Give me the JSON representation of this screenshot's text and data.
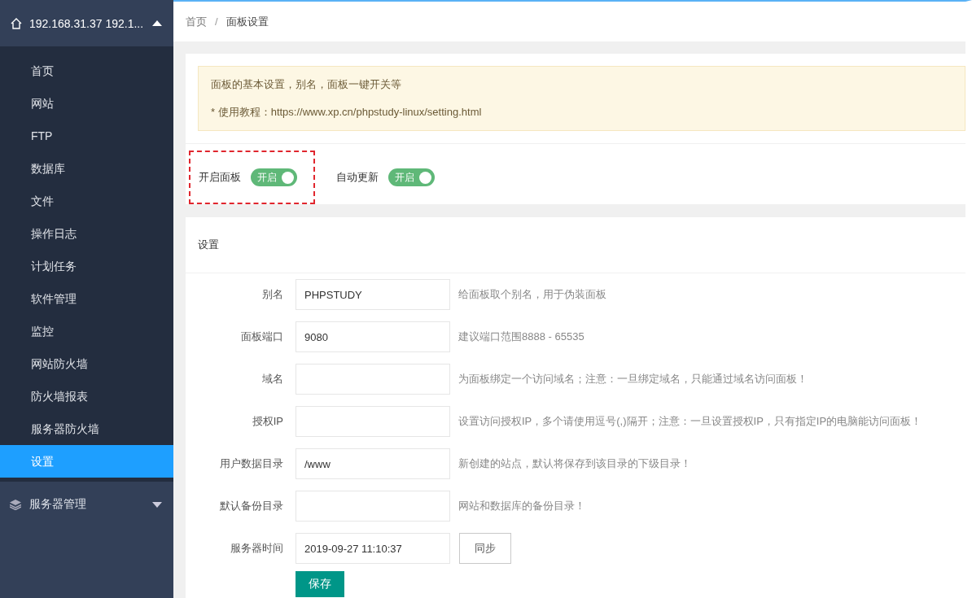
{
  "sidebar": {
    "header": {
      "title": "192.168.31.37 192.1...",
      "expanded": true
    },
    "items": [
      {
        "label": "首页",
        "selected": false
      },
      {
        "label": "网站",
        "selected": false
      },
      {
        "label": "FTP",
        "selected": false
      },
      {
        "label": "数据库",
        "selected": false
      },
      {
        "label": "文件",
        "selected": false
      },
      {
        "label": "操作日志",
        "selected": false
      },
      {
        "label": "计划任务",
        "selected": false
      },
      {
        "label": "软件管理",
        "selected": false
      },
      {
        "label": "监控",
        "selected": false
      },
      {
        "label": "网站防火墙",
        "selected": false
      },
      {
        "label": "防火墙报表",
        "selected": false
      },
      {
        "label": "服务器防火墙",
        "selected": false
      },
      {
        "label": "设置",
        "selected": true
      }
    ],
    "group": {
      "label": "服务器管理",
      "expanded": false
    }
  },
  "breadcrumb": {
    "items": [
      "首页",
      "面板设置"
    ],
    "separator": "/"
  },
  "notice": {
    "lines": [
      "面板的基本设置，别名，面板一键开关等",
      "* 使用教程：https://www.xp.cn/phpstudy-linux/setting.html"
    ]
  },
  "toggles": [
    {
      "label": "开启面板",
      "state_text": "开启",
      "on": true,
      "highlighted": true
    },
    {
      "label": "自动更新",
      "state_text": "开启",
      "on": true,
      "highlighted": false
    }
  ],
  "settings": {
    "title": "设置",
    "fields": [
      {
        "label": "别名",
        "value": "PHPSTUDY",
        "hint": "给面板取个别名，用于伪装面板"
      },
      {
        "label": "面板端口",
        "value": "9080",
        "hint": "建议端口范围8888 - 65535"
      },
      {
        "label": "域名",
        "hint": "为面板绑定一个访问域名；注意：一旦绑定域名，只能通过域名访问面板！"
      },
      {
        "label": "授权IP",
        "hint": "设置访问授权IP，多个请使用逗号(,)隔开；注意：一旦设置授权IP，只有指定IP的电脑能访问面板！"
      },
      {
        "label": "用户数据目录",
        "value": "/www",
        "hint": "新创建的站点，默认将保存到该目录的下级目录！"
      },
      {
        "label": "默认备份目录",
        "hint": "网站和数据库的备份目录！"
      },
      {
        "label": "服务器时间",
        "value": "2019-09-27 11:10:37",
        "button": "同步"
      }
    ],
    "save_button": "保存"
  }
}
